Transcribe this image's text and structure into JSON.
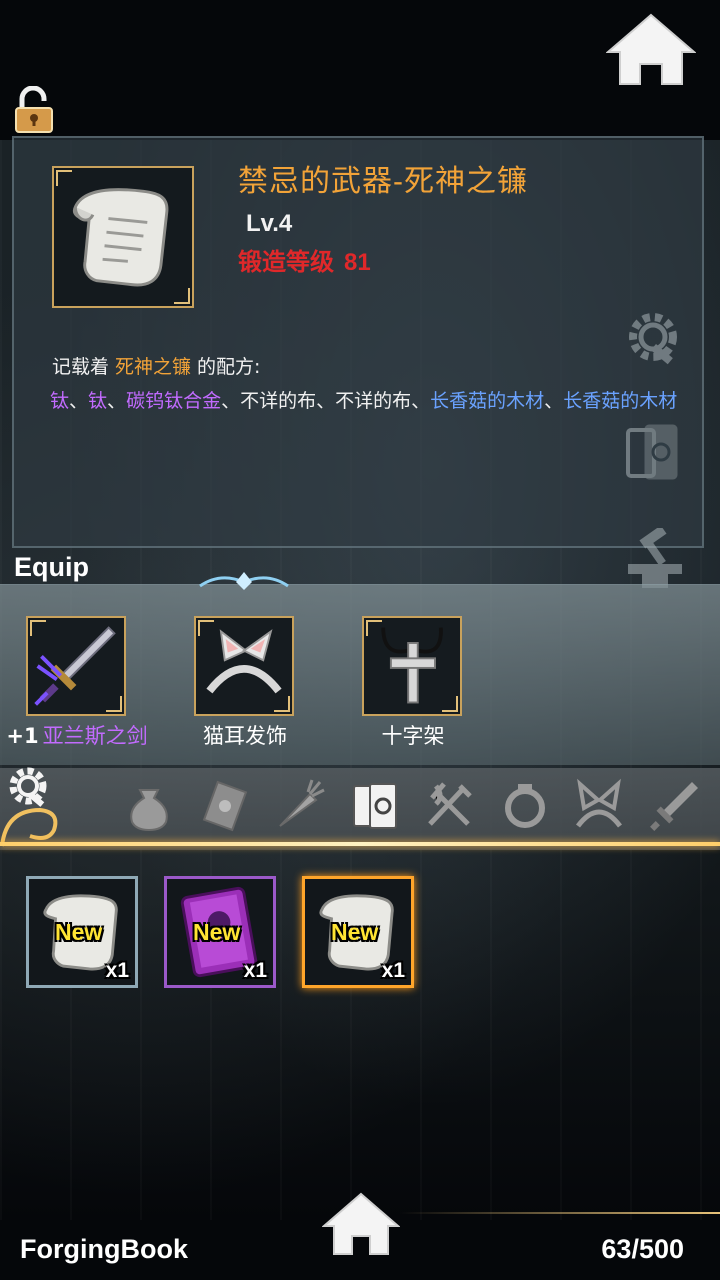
{
  "recipe": {
    "title": "禁忌的武器-死神之镰",
    "level": "Lv.4",
    "forge_label": "锻造等级",
    "forge_value": "81",
    "intro_prefix": "记载着",
    "intro_item": "死神之镰",
    "intro_suffix": "的配方:",
    "materials": [
      {
        "name": "钛",
        "color": "purple"
      },
      {
        "name": "钛",
        "color": "purple"
      },
      {
        "name": "碳钨钛合金",
        "color": "purple"
      },
      {
        "name": "不详的布",
        "color": "white"
      },
      {
        "name": "不详的布",
        "color": "white"
      },
      {
        "name": "长香菇的木材",
        "color": "blue"
      },
      {
        "name": "长香菇的木材",
        "color": "blue"
      }
    ],
    "separator": "、"
  },
  "equip": {
    "label": "Equip",
    "slots": [
      {
        "prefix": "+1",
        "name": "亚兰斯之剑",
        "icon": "sword-icon"
      },
      {
        "prefix": "",
        "name": "猫耳发饰",
        "icon": "cat-ear-headband-icon"
      },
      {
        "prefix": "",
        "name": "十字架",
        "icon": "cross-necklace-icon"
      }
    ]
  },
  "tabs": [
    "bag-icon",
    "card-icon",
    "carrot-icon",
    "book-icon",
    "utensils-icon",
    "ring-icon",
    "cat-ear-icon",
    "sword-icon"
  ],
  "inventory": [
    {
      "badge": "New",
      "count": "x1",
      "icon": "scroll-icon"
    },
    {
      "badge": "New",
      "count": "x1",
      "icon": "purple-book-icon"
    },
    {
      "badge": "New",
      "count": "x1",
      "icon": "scroll-icon"
    }
  ],
  "footer": {
    "title": "ForgingBook",
    "count": "63/500"
  },
  "colors": {
    "title_orange": "#f2a338",
    "forge_red": "#e0282a",
    "material_purple": "#c26bff",
    "material_blue": "#6aa2ff",
    "new_yellow": "#ffe433",
    "frame_gold": "#c9a25c",
    "selected_orange": "#ffa52a"
  }
}
